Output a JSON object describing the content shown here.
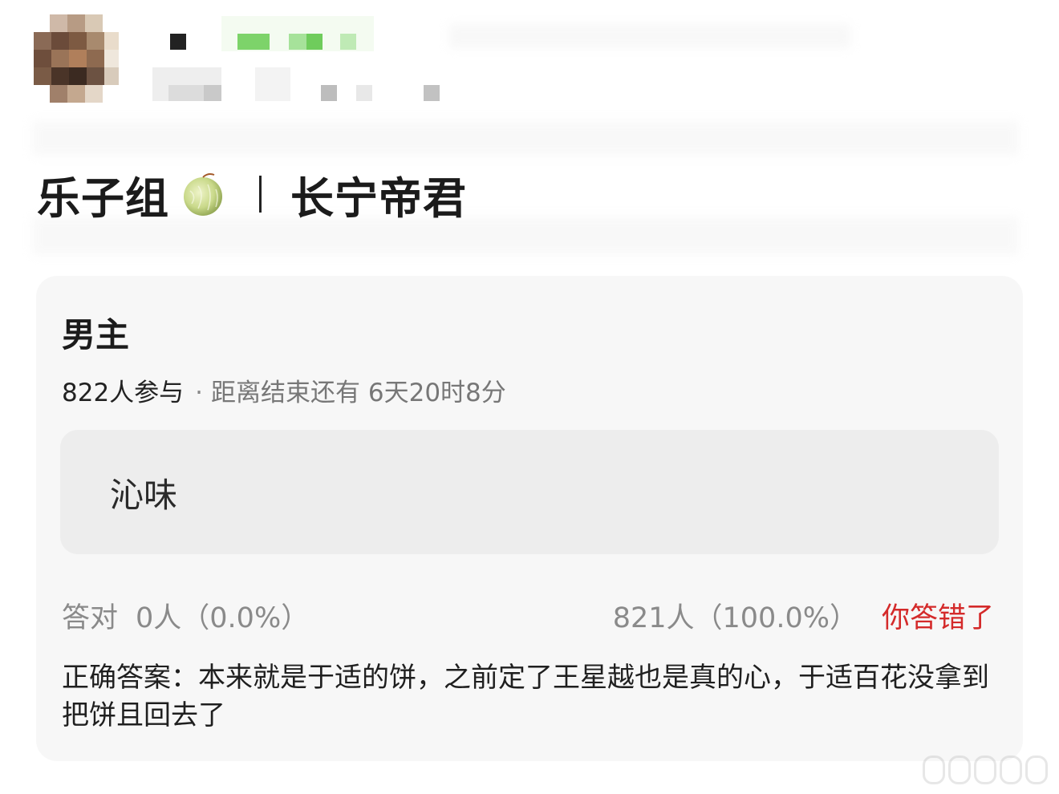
{
  "post": {
    "title_left": "乐子组",
    "title_right": "长宁帝君"
  },
  "poll": {
    "question": "男主",
    "participants": "822人参与",
    "separator": "·",
    "remaining": "距离结束还有 6天20时8分",
    "option_label": "沁味",
    "correct_label": "答对",
    "correct_count": "0人（0.0%）",
    "option_count": "821人（100.0%）",
    "result_text": "你答错了",
    "answer_text": "正确答案：本来就是于适的饼，之前定了王星越也是真的心，于适百花没拿到把饼且回去了"
  },
  "colors": {
    "wrong": "#d42a2a",
    "card_bg": "#f7f7f7",
    "option_bg": "#ededed",
    "muted": "#8a8a8a"
  },
  "icons": {
    "melon": "melon-emoji-icon"
  }
}
